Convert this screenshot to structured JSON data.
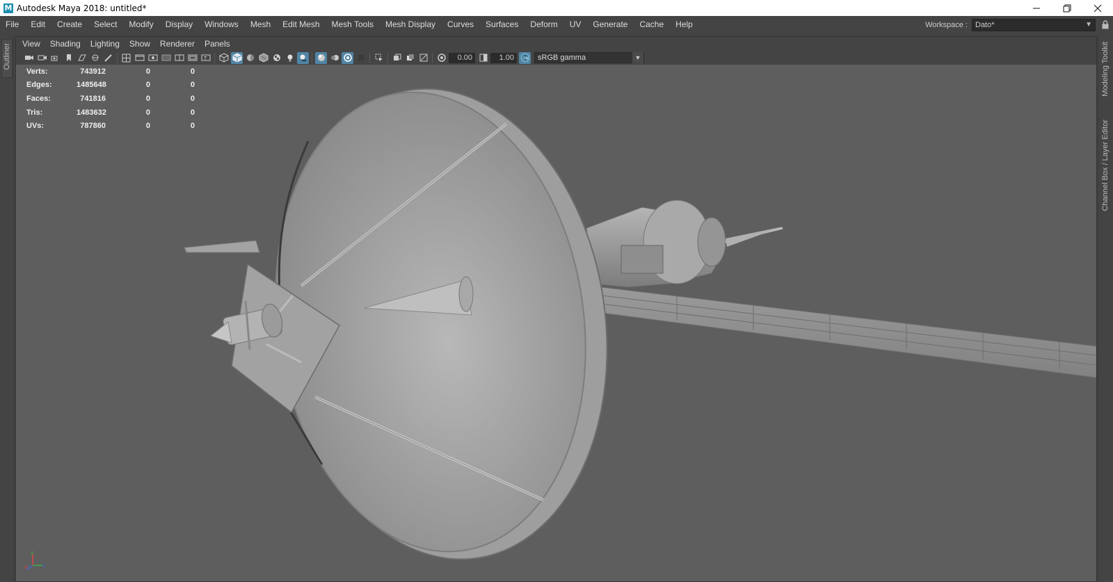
{
  "window": {
    "title": "Autodesk Maya 2018: untitled*",
    "icon_letter": "M",
    "controls": [
      "minimize-icon",
      "restore-icon",
      "close-icon"
    ]
  },
  "main_menu": [
    "File",
    "Edit",
    "Create",
    "Select",
    "Modify",
    "Display",
    "Windows",
    "Mesh",
    "Edit Mesh",
    "Mesh Tools",
    "Mesh Display",
    "Curves",
    "Surfaces",
    "Deform",
    "UV",
    "Generate",
    "Cache",
    "Help"
  ],
  "workspace": {
    "label": "Workspace :",
    "value": "Dato*"
  },
  "left_strip": {
    "outliner_label": "Outliner"
  },
  "right_strip": {
    "modeling_toolkit_label": "Modeling Toolkit",
    "channel_box_label": "Channel Box / Layer Editor"
  },
  "panel_menu": [
    "View",
    "Shading",
    "Lighting",
    "Show",
    "Renderer",
    "Panels"
  ],
  "panel_toolbar": {
    "exposure_value": "0.00",
    "gamma_value": "1.00",
    "color_space": "sRGB gamma"
  },
  "hud": {
    "rows": [
      {
        "label": "Verts:",
        "v1": "743912",
        "v2": "0",
        "v3": "0"
      },
      {
        "label": "Edges:",
        "v1": "1485648",
        "v2": "0",
        "v3": "0"
      },
      {
        "label": "Faces:",
        "v1": "741816",
        "v2": "0",
        "v3": "0"
      },
      {
        "label": "Tris:",
        "v1": "1483632",
        "v2": "0",
        "v3": "0"
      },
      {
        "label": "UVs:",
        "v1": "787860",
        "v2": "0",
        "v3": "0"
      }
    ]
  },
  "colors": {
    "viewport_bg": "#5e5e5e",
    "ui_bg": "#444444",
    "active_icon": "#5285a6"
  }
}
